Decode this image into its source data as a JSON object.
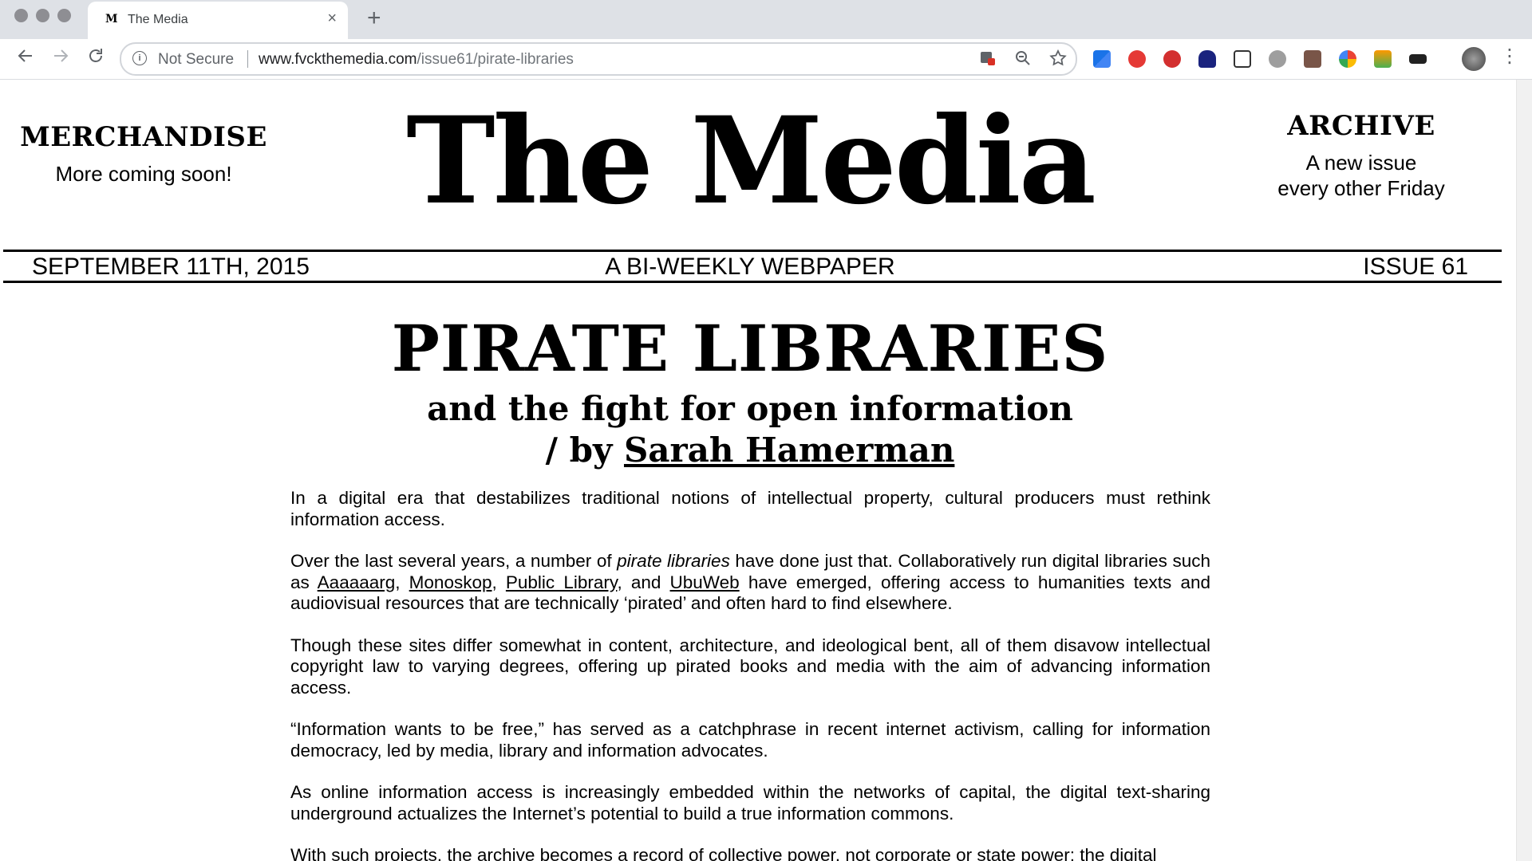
{
  "browser": {
    "tab_favicon": "M",
    "tab_title": "The Media",
    "tab_close": "×",
    "new_tab": "+",
    "security_label": "Not Secure",
    "url_host": "www.fvckthemedia.com",
    "url_path": "/issue61/pirate-libraries",
    "icons": [
      "back-icon",
      "forward-icon",
      "reload-icon",
      "info-icon",
      "translate-icon",
      "zoom-icon",
      "star-icon",
      "menu-icon"
    ]
  },
  "header": {
    "left_title": "MERCHANDISE",
    "left_text": "More coming soon!",
    "masthead": "The Media",
    "right_title": "ARCHIVE",
    "right_text_line1": "A new issue",
    "right_text_line2": "every other Friday"
  },
  "dateline": {
    "date": "SEPTEMBER 11TH, 2015",
    "tagline": "A BI-WEEKLY WEBPAPER",
    "issue": "ISSUE 61"
  },
  "article": {
    "headline": "PIRATE LIBRARIES",
    "subhead": "and the fight for open information",
    "byline_prefix": "/ by ",
    "author": "Sarah Hamerman",
    "p1": "In a digital era that destabilizes traditional notions of intellectual property, cultural producers must rethink information access.",
    "p2_a": "Over the last several years, a number of ",
    "p2_em": "pirate libraries",
    "p2_b": " have done just that. Collaboratively run digital libraries such as ",
    "link1": "Aaaaaarg",
    "sep1": ", ",
    "link2": "Monoskop",
    "sep2": ", ",
    "link3": "Public Library",
    "sep3": ", and ",
    "link4": "UbuWeb",
    "p2_c": " have emerged, offering access to humanities texts and audiovisual resources that are technically ‘pirated’ and often hard to find elsewhere.",
    "p3": "Though these sites differ somewhat in content, architecture, and ideological bent, all of them disavow intellectual copyright law to varying degrees, offering up pirated books and media with the aim of advancing information access.",
    "p4": "“Information wants to be free,” has served as a catchphrase in recent internet activism, calling for information democracy, led by media, library and information advocates.",
    "p5": "As online information access is increasingly embedded within the networks of capital, the digital text-sharing underground actualizes the Internet’s potential to build a true information commons.",
    "p6": "With such projects, the archive becomes a record of collective power, not corporate or state power; the digital"
  }
}
